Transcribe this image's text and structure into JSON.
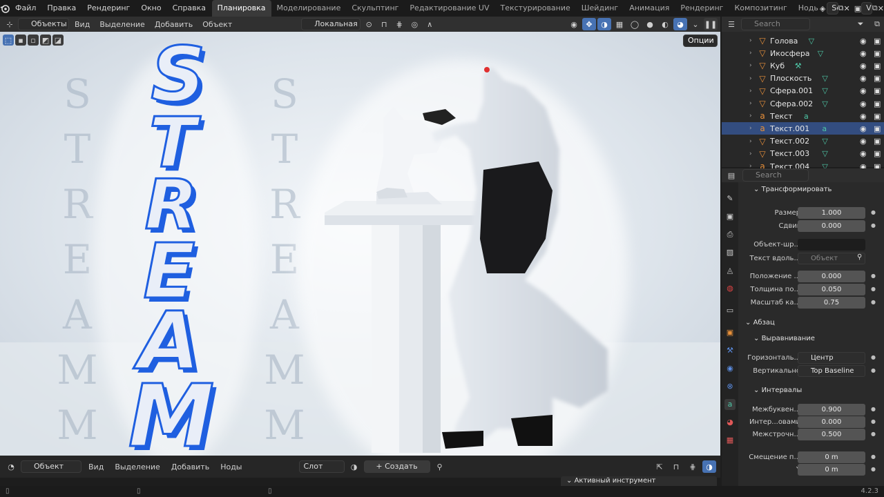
{
  "topbar": {
    "menus": [
      "Файл",
      "Правка",
      "Рендеринг",
      "Окно",
      "Справка"
    ],
    "workspaces": [
      "Планировка",
      "Моделирование",
      "Скульптинг",
      "Редактирование UV",
      "Текстурирование",
      "Шейдинг",
      "Анимация",
      "Рендеринг",
      "Композитинг",
      "Нодь"
    ],
    "scene": "Scene",
    "view_layer": "ViewLayer"
  },
  "viewport": {
    "mode": "Объекты",
    "menus": [
      "Вид",
      "Выделение",
      "Добавить",
      "Объект"
    ],
    "transform_orientation": "Локальная",
    "options": "Опции",
    "render_text": "STREAM",
    "bg_text": "STREAM"
  },
  "shader_editor": {
    "mode": "Объект",
    "menus": [
      "Вид",
      "Выделение",
      "Добавить",
      "Ноды"
    ],
    "slot": "Слот",
    "new_label": "Создать"
  },
  "active_tool_panel": "Активный инструмент",
  "outliner": {
    "search_placeholder": "Search",
    "items": [
      {
        "name": "Голова",
        "type": "mesh",
        "mod": "▽"
      },
      {
        "name": "Икосфера",
        "type": "mesh",
        "mod": "▽"
      },
      {
        "name": "Куб",
        "type": "mesh",
        "mod": "⚒"
      },
      {
        "name": "Плоскость",
        "type": "mesh",
        "mod": "▽"
      },
      {
        "name": "Сфера.001",
        "type": "mesh",
        "mod": "▽"
      },
      {
        "name": "Сфера.002",
        "type": "mesh",
        "mod": "▽"
      },
      {
        "name": "Текст",
        "type": "text",
        "mod": "a"
      },
      {
        "name": "Текст.001",
        "type": "text",
        "mod": "a",
        "selected": true
      },
      {
        "name": "Текст.002",
        "type": "mesh",
        "mod": "▽"
      },
      {
        "name": "Текст.003",
        "type": "mesh",
        "mod": "▽"
      },
      {
        "name": "Текст.004",
        "type": "text",
        "mod": "▽"
      }
    ]
  },
  "properties": {
    "search_placeholder": "Search",
    "transform": {
      "title": "Трансформировать",
      "size_label": "Размер",
      "size": "1.000",
      "shift_label": "Сдвиг",
      "shift": "0.000",
      "font_obj_label": "Объект-шр...",
      "text_along_label": "Текст вдоль...",
      "text_along_placeholder": "Объект",
      "offset_label": "Положение ...",
      "offset": "0.000",
      "thickness_label": "Толщина по...",
      "thickness": "0.050",
      "scale_label": "Масштаб ка...",
      "scale": "0.75"
    },
    "paragraph": {
      "title": "Абзац",
      "alignment_title": "Выравнивание",
      "horizontal_label": "Горизонталь...",
      "horizontal": "Центр",
      "vertical_label": "Вертикально",
      "vertical": "Top Baseline",
      "spacing_title": "Интервалы",
      "char_label": "Межбуквен...",
      "char": "0.900",
      "word_label": "Интер...овами",
      "word": "0.000",
      "line_label": "Межстрочн...",
      "line": "0.500",
      "offset_x_label": "Смещение п...",
      "offset_x": "0 m",
      "offset_y_label": "Y",
      "offset_y": "0 m"
    }
  },
  "status": {
    "version": "4.2.3"
  },
  "colors": {
    "accent": "#4772b3",
    "selected_row": "#334d80",
    "text_blue": "#1f5fe0",
    "modifier": "#4ec6a6",
    "object": "#e8903a"
  }
}
